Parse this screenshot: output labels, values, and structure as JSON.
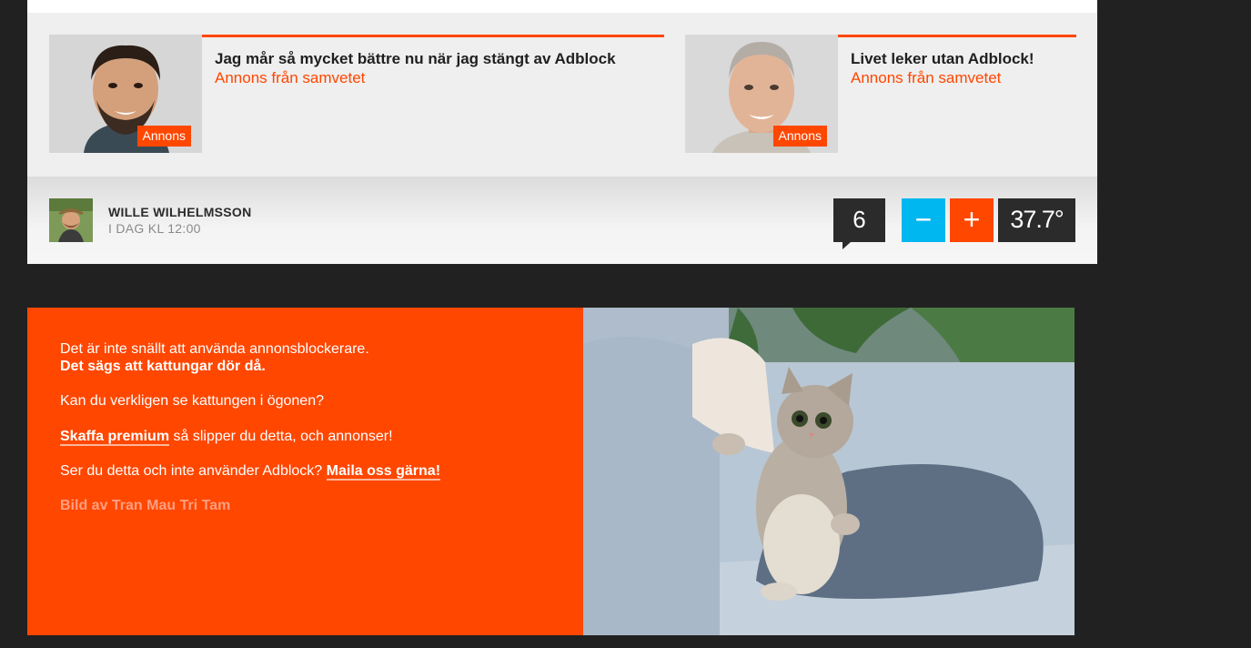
{
  "ads": [
    {
      "badge": "Annons",
      "title": "Jag mår så mycket bättre nu när jag stängt av Adblock",
      "source": "Annons från samvetet",
      "image_icon": "man-portrait"
    },
    {
      "badge": "Annons",
      "title": "Livet leker utan Adblock!",
      "source": "Annons från samvetet",
      "image_icon": "man-portrait"
    }
  ],
  "author": {
    "name": "WILLE WILHELMSSON",
    "time": "I DAG KL 12:00"
  },
  "stats": {
    "comments": "6",
    "minus_label": "−",
    "plus_label": "+",
    "temperature": "37.7°"
  },
  "banner": {
    "line1": "Det är inte snällt att använda annonsblockerare.",
    "line2": "Det sägs att kattungar dör då.",
    "line3": "Kan du verkligen se kattungen i ögonen?",
    "premium_link": "Skaffa premium",
    "premium_rest": " så slipper du detta, och annonser!",
    "mail_prefix": "Ser du detta och inte använder Adblock? ",
    "mail_link": "Maila oss gärna!",
    "credit": "Bild av Tran Mau Tri Tam",
    "image_icon": "kitten-on-sofa"
  },
  "colors": {
    "accent": "#ff4700",
    "blue": "#00b7ef",
    "dark": "#2b2b2b",
    "background": "#212121"
  }
}
